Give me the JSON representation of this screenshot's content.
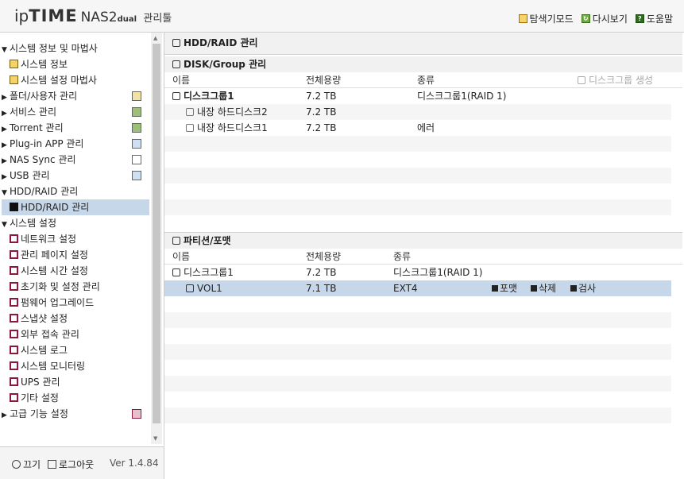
{
  "header": {
    "logo_ip": "ip",
    "logo_time": "TIME",
    "logo_nas": "NAS2",
    "logo_dual": "dual",
    "logo_admin": "관리툴",
    "nav": [
      "탐색기모드",
      "다시보기",
      "도움말"
    ]
  },
  "sidebar": {
    "items": [
      {
        "label": "시스템 정보 및 마법사"
      },
      {
        "label": "시스템 정보"
      },
      {
        "label": "시스템 설정 마법사"
      },
      {
        "label": "폴더/사용자 관리"
      },
      {
        "label": "서비스 관리"
      },
      {
        "label": "Torrent 관리"
      },
      {
        "label": "Plug-in APP 관리"
      },
      {
        "label": "NAS Sync 관리"
      },
      {
        "label": "USB 관리"
      },
      {
        "label": "HDD/RAID 관리"
      },
      {
        "label": "HDD/RAID 관리"
      },
      {
        "label": "시스템 설정"
      },
      {
        "label": "네트워크 설정"
      },
      {
        "label": "관리 페이지 설정"
      },
      {
        "label": "시스템 시간 설정"
      },
      {
        "label": "초기화 및 설정 관리"
      },
      {
        "label": "펌웨어 업그레이드"
      },
      {
        "label": "스냅샷 설정"
      },
      {
        "label": "외부 접속 관리"
      },
      {
        "label": "시스템 로그"
      },
      {
        "label": "시스템 모니터링"
      },
      {
        "label": "UPS 관리"
      },
      {
        "label": "기타 설정"
      },
      {
        "label": "고급 기능 설정"
      }
    ]
  },
  "footer": {
    "power_label": "끄기",
    "logout_label": "로그아웃",
    "version": "Ver 1.4.84"
  },
  "main": {
    "title": "HDD/RAID 관리",
    "disk_section": {
      "title": "DISK/Group 관리",
      "columns": [
        "이름",
        "전체용량",
        "종류"
      ],
      "create_label": "디스크그룹 생성",
      "rows": [
        {
          "name": "디스크그룹1",
          "size": "7.2 TB",
          "type": "디스크그룹1(RAID 1)"
        },
        {
          "name": "내장 하드디스크2",
          "size": "7.2 TB",
          "type": ""
        },
        {
          "name": "내장 하드디스크1",
          "size": "7.2 TB",
          "type": "에러"
        }
      ]
    },
    "partition_section": {
      "title": "파티션/포맷",
      "columns": [
        "이름",
        "전체용량",
        "종류"
      ],
      "rows": [
        {
          "name": "디스크그룹1",
          "size": "7.2 TB",
          "type": "디스크그룹1(RAID 1)"
        },
        {
          "name": "VOL1",
          "size": "7.1 TB",
          "type": "EXT4"
        }
      ],
      "actions": [
        "포맷",
        "삭제",
        "검사"
      ]
    }
  }
}
